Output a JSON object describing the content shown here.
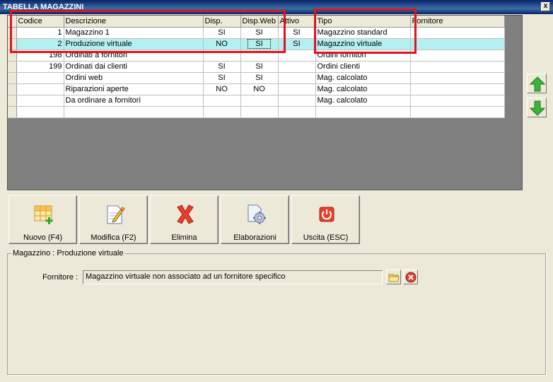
{
  "window": {
    "title": "TABELLA MAGAZZINI",
    "close_label": "x"
  },
  "grid": {
    "columns": [
      "Codice",
      "Descrizione",
      "Disp.",
      "Disp.Web",
      "Attivo",
      "Tipo",
      "Fornitore"
    ],
    "rows": [
      {
        "codice": "1",
        "descrizione": "Magazzino 1",
        "disp": "SI",
        "dispweb": "SI",
        "attivo": "SI",
        "tipo": "Magazzino standard",
        "fornitore": ""
      },
      {
        "codice": "2",
        "descrizione": "Produzione virtuale",
        "disp": "NO",
        "dispweb": "SI",
        "attivo": "SI",
        "tipo": "Magazzino virtuale",
        "fornitore": ""
      },
      {
        "codice": "198",
        "descrizione": "Ordinati a fornitori",
        "disp": "",
        "dispweb": "",
        "attivo": "",
        "tipo": "Ordini fornitori",
        "fornitore": ""
      },
      {
        "codice": "199",
        "descrizione": "Ordinati dai clienti",
        "disp": "SI",
        "dispweb": "SI",
        "attivo": "",
        "tipo": "Ordini clienti",
        "fornitore": ""
      },
      {
        "codice": "",
        "descrizione": "Ordini web",
        "disp": "SI",
        "dispweb": "SI",
        "attivo": "",
        "tipo": "Mag. calcolato",
        "fornitore": ""
      },
      {
        "codice": "",
        "descrizione": "Riparazioni aperte",
        "disp": "NO",
        "dispweb": "NO",
        "attivo": "",
        "tipo": "Mag. calcolato",
        "fornitore": ""
      },
      {
        "codice": "",
        "descrizione": "Da ordinare a fornitori",
        "disp": "",
        "dispweb": "",
        "attivo": "",
        "tipo": "Mag. calcolato",
        "fornitore": ""
      },
      {
        "codice": "",
        "descrizione": "",
        "disp": "",
        "dispweb": "",
        "attivo": "",
        "tipo": "",
        "fornitore": ""
      }
    ],
    "selected_row_index": 1
  },
  "toolbar": {
    "nuovo": "Nuovo (F4)",
    "modifica": "Modifica (F2)",
    "elimina": "Elimina",
    "elaborazioni": "Elaborazioni",
    "uscita": "Uscita (ESC)"
  },
  "detail": {
    "group_title": "Magazzino : Produzione virtuale",
    "fornitore_label": "Fornitore :",
    "fornitore_value": "Magazzino virtuale non associato ad un fornitore specifico"
  },
  "colors": {
    "selection": "#b4f0f0",
    "highlight_box": "#e0141e",
    "arrow_green": "#3cb43c"
  },
  "icons": {
    "up": "arrow-up-icon",
    "down": "arrow-down-icon",
    "new": "grid-add-icon",
    "edit": "edit-document-icon",
    "delete": "red-x-icon",
    "process": "gear-document-icon",
    "exit": "power-icon",
    "browse": "folder-icon",
    "clear": "clear-x-icon"
  }
}
